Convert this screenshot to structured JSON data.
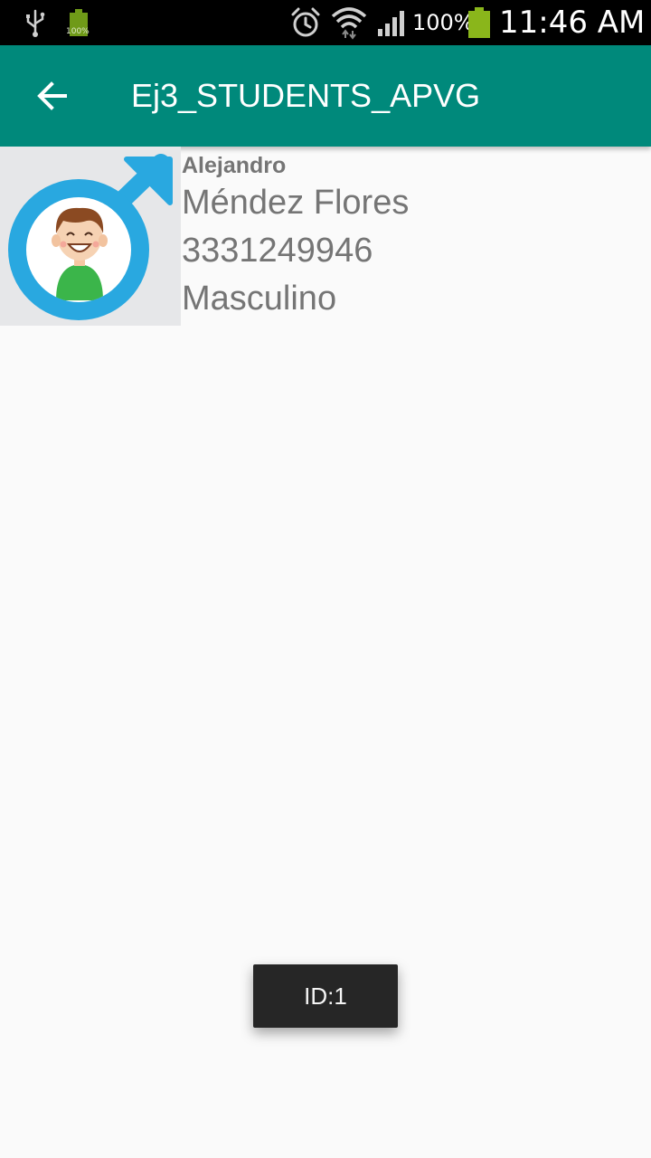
{
  "status_bar": {
    "small_battery_label": "100%",
    "battery_percent": "100%",
    "time": "11:46 AM",
    "icons": [
      "usb-icon",
      "battery-charged-icon",
      "alarm-icon",
      "wifi-icon",
      "signal-icon",
      "battery-icon"
    ]
  },
  "toolbar": {
    "title": "Ej3_STUDENTS_APVG",
    "back_icon": "arrow-back-icon",
    "color": "#00897b"
  },
  "student": {
    "first_name": "Alejandro",
    "last_names": "Méndez Flores",
    "phone": "3331249946",
    "gender": "Masculino",
    "avatar_icon": "male-symbol-avatar-icon"
  },
  "toast": {
    "text": "ID:1"
  },
  "colors": {
    "accent": "#00897b",
    "male_symbol": "#29a8e0",
    "text_secondary": "#757575"
  }
}
